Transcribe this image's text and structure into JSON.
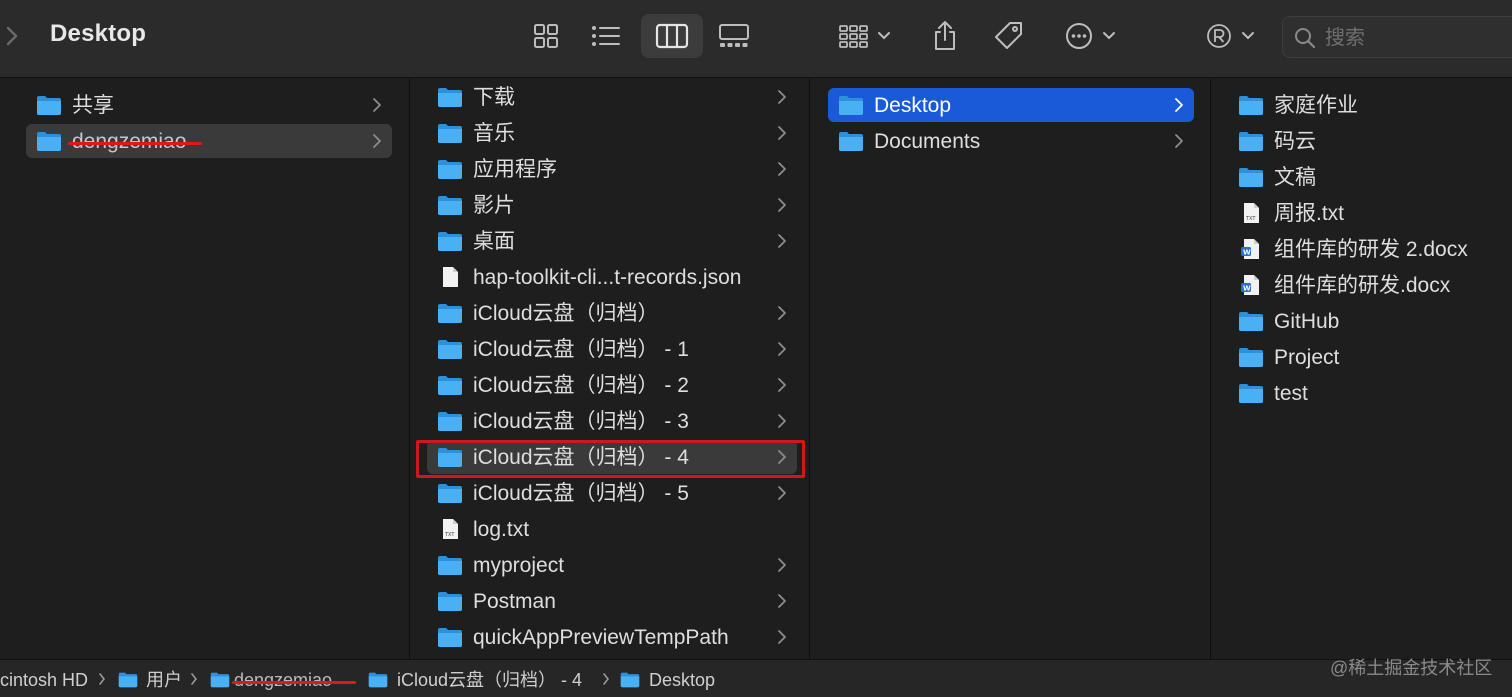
{
  "toolbar": {
    "title": "Desktop",
    "search_placeholder": "搜索"
  },
  "columns": {
    "col1": [
      {
        "label": "共享",
        "icon": "folder-icon",
        "chevron": true
      },
      {
        "label": "dengzemiao",
        "icon": "home-folder-icon",
        "chevron": true,
        "selected": true,
        "redacted": true
      }
    ],
    "col2": [
      {
        "label": "下载",
        "icon": "downloads-folder-icon",
        "chevron": true
      },
      {
        "label": "音乐",
        "icon": "music-folder-icon",
        "chevron": true
      },
      {
        "label": "应用程序",
        "icon": "applications-folder-icon",
        "chevron": true
      },
      {
        "label": "影片",
        "icon": "movies-folder-icon",
        "chevron": true
      },
      {
        "label": "桌面",
        "icon": "desktop-folder-icon",
        "chevron": true
      },
      {
        "label": "hap-toolkit-cli...t-records.json",
        "icon": "file-icon",
        "chevron": false
      },
      {
        "label": "iCloud云盘（归档）",
        "icon": "folder-icon",
        "chevron": true
      },
      {
        "label": "iCloud云盘（归档） - 1",
        "icon": "folder-icon",
        "chevron": true
      },
      {
        "label": "iCloud云盘（归档） - 2",
        "icon": "folder-icon",
        "chevron": true
      },
      {
        "label": "iCloud云盘（归档） - 3",
        "icon": "folder-icon",
        "chevron": true
      },
      {
        "label": "iCloud云盘（归档） - 4",
        "icon": "folder-icon",
        "chevron": true,
        "selected": true
      },
      {
        "label": "iCloud云盘（归档） - 5",
        "icon": "folder-icon",
        "chevron": true
      },
      {
        "label": "log.txt",
        "icon": "txt-file-icon",
        "chevron": false
      },
      {
        "label": "myproject",
        "icon": "folder-icon",
        "chevron": true
      },
      {
        "label": "Postman",
        "icon": "folder-icon",
        "chevron": true
      },
      {
        "label": "quickAppPreviewTempPath",
        "icon": "folder-icon",
        "chevron": true
      }
    ],
    "col3": [
      {
        "label": "Desktop",
        "icon": "folder-icon",
        "chevron": true,
        "active": true
      },
      {
        "label": "Documents",
        "icon": "folder-icon",
        "chevron": true
      }
    ],
    "col4": [
      {
        "label": "家庭作业",
        "icon": "folder-icon"
      },
      {
        "label": "码云",
        "icon": "folder-icon"
      },
      {
        "label": "文稿",
        "icon": "folder-icon"
      },
      {
        "label": "周报.txt",
        "icon": "txt-file-icon"
      },
      {
        "label": "组件库的研发 2.docx",
        "icon": "word-doc-icon"
      },
      {
        "label": "组件库的研发.docx",
        "icon": "word-doc-icon"
      },
      {
        "label": "GitHub",
        "icon": "folder-icon"
      },
      {
        "label": "Project",
        "icon": "folder-icon"
      },
      {
        "label": "test",
        "icon": "folder-icon"
      }
    ]
  },
  "pathbar": {
    "disk": "cintosh HD",
    "users": "用户",
    "home": "dengzemiao",
    "archive": "iCloud云盘（归档） - 4",
    "desktop": "Desktop"
  },
  "watermark": "@稀土掘金技术社区",
  "colors": {
    "accent": "#1a5ad8",
    "folder": "#3ea6f0",
    "annotation_red": "#d01818"
  }
}
